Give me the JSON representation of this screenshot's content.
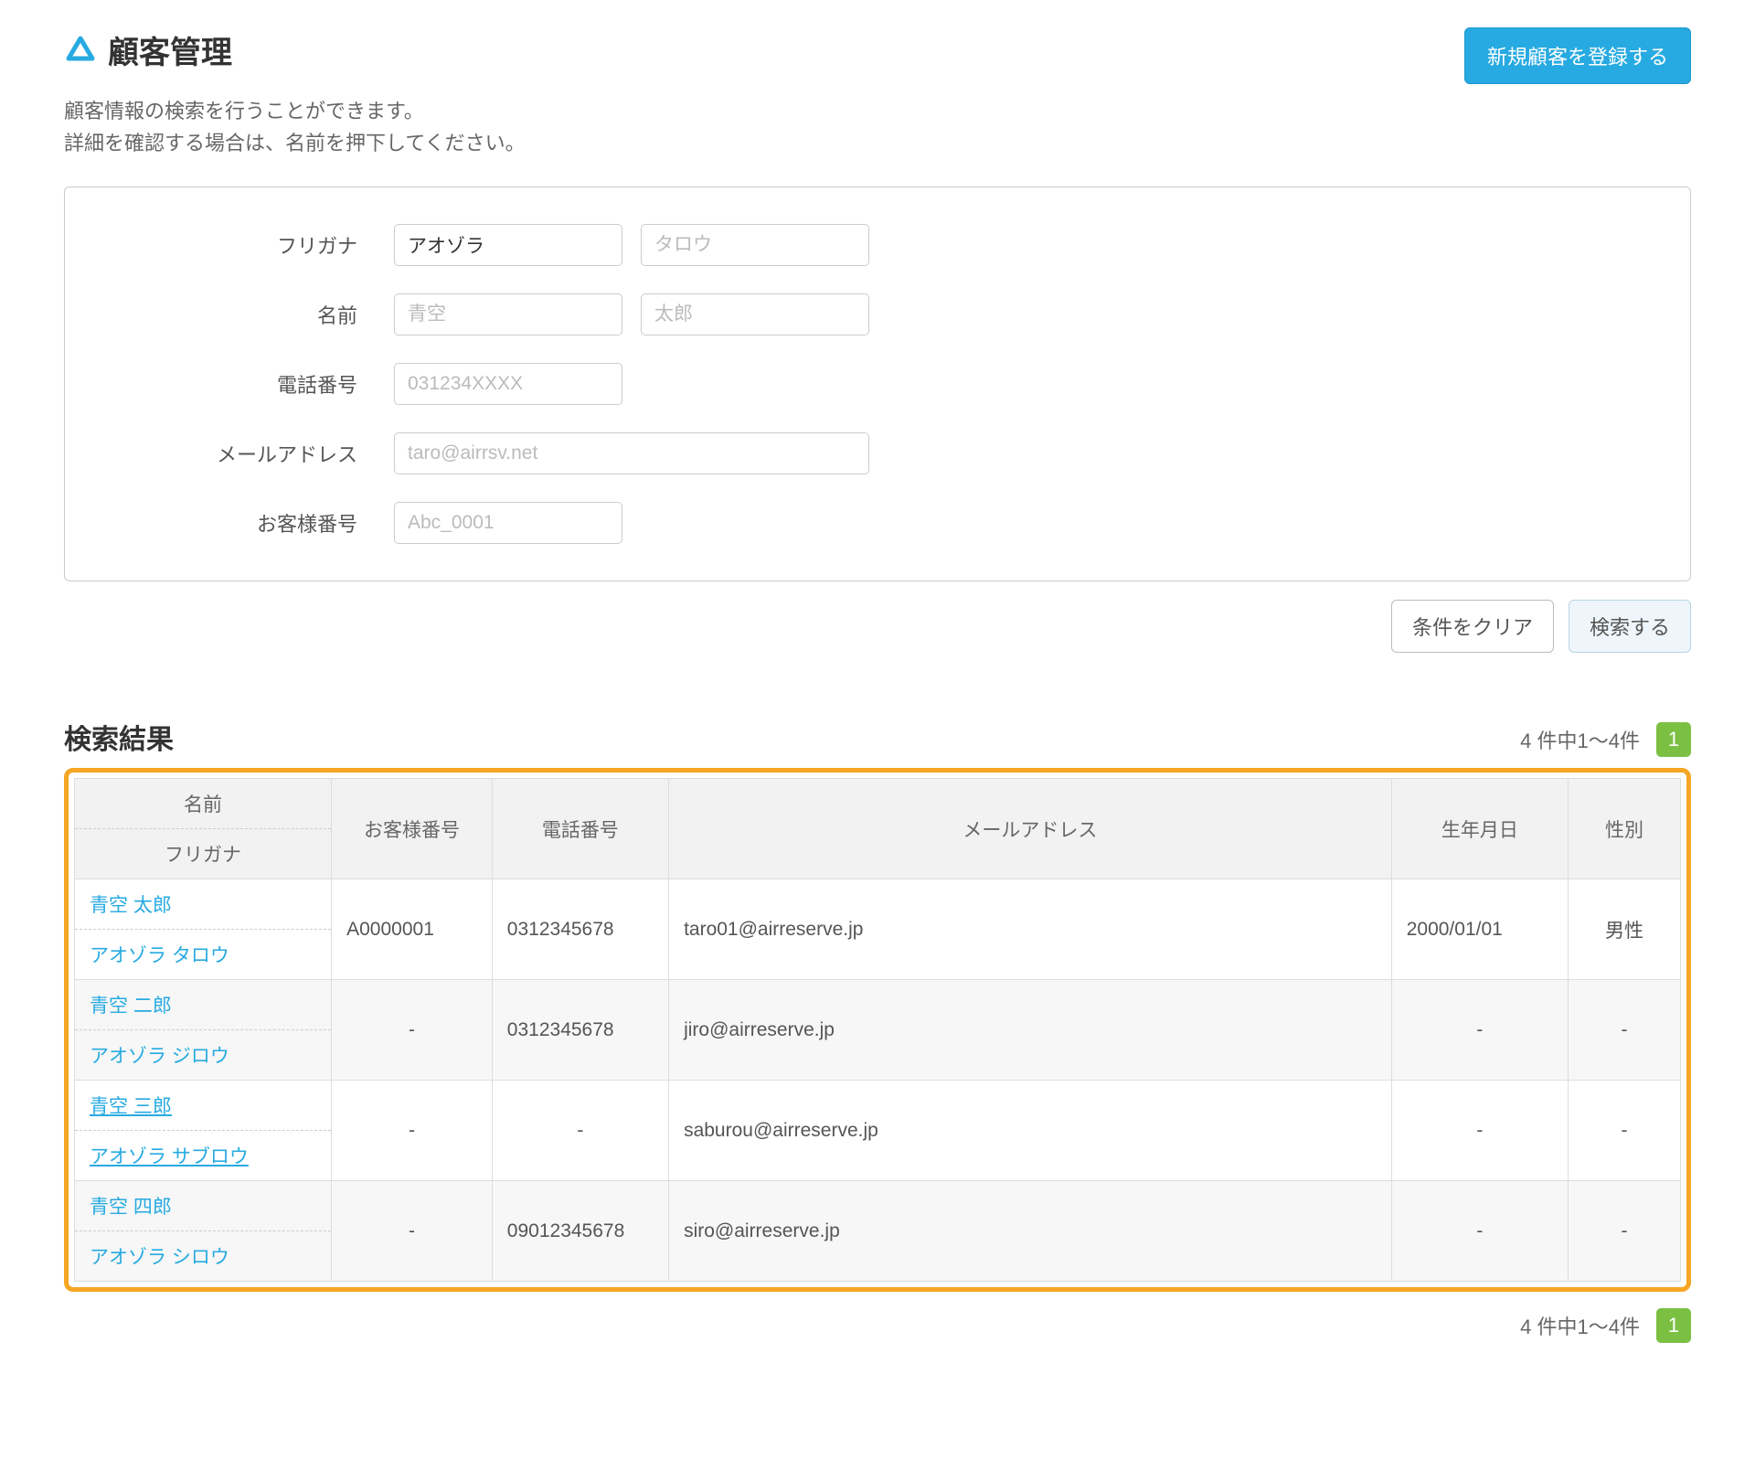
{
  "header": {
    "title": "顧客管理",
    "register_button": "新規顧客を登録する",
    "subtext_line1": "顧客情報の検索を行うことができます。",
    "subtext_line2": "詳細を確認する場合は、名前を押下してください。"
  },
  "search_form": {
    "furigana": {
      "label": "フリガナ",
      "value1": "アオゾラ",
      "placeholder2": "タロウ"
    },
    "name": {
      "label": "名前",
      "placeholder1": "青空",
      "placeholder2": "太郎"
    },
    "phone": {
      "label": "電話番号",
      "placeholder": "031234XXXX"
    },
    "email": {
      "label": "メールアドレス",
      "placeholder": "taro@airrsv.net"
    },
    "customer_no": {
      "label": "お客様番号",
      "placeholder": "Abc_0001"
    }
  },
  "actions": {
    "clear": "条件をクリア",
    "search": "検索する"
  },
  "results": {
    "heading": "検索結果",
    "count_text": "4 件中1〜4件",
    "page": "1",
    "columns": {
      "name_top": "名前",
      "name_bottom": "フリガナ",
      "customer_no": "お客様番号",
      "phone": "電話番号",
      "email": "メールアドレス",
      "birthdate": "生年月日",
      "gender": "性別"
    },
    "rows": [
      {
        "name": "青空 太郎",
        "kana": "アオゾラ タロウ",
        "customer_no": "A0000001",
        "phone": "0312345678",
        "email": "taro01@airreserve.jp",
        "birthdate": "2000/01/01",
        "gender": "男性",
        "underlined": false
      },
      {
        "name": "青空 二郎",
        "kana": "アオゾラ ジロウ",
        "customer_no": "-",
        "phone": "0312345678",
        "email": "jiro@airreserve.jp",
        "birthdate": "-",
        "gender": "-",
        "underlined": false
      },
      {
        "name": "青空 三郎",
        "kana": "アオゾラ サブロウ",
        "customer_no": "-",
        "phone": "-",
        "email": "saburou@airreserve.jp",
        "birthdate": "-",
        "gender": "-",
        "underlined": true
      },
      {
        "name": "青空 四郎",
        "kana": "アオゾラ シロウ",
        "customer_no": "-",
        "phone": "09012345678",
        "email": "siro@airreserve.jp",
        "birthdate": "-",
        "gender": "-",
        "underlined": false
      }
    ]
  }
}
